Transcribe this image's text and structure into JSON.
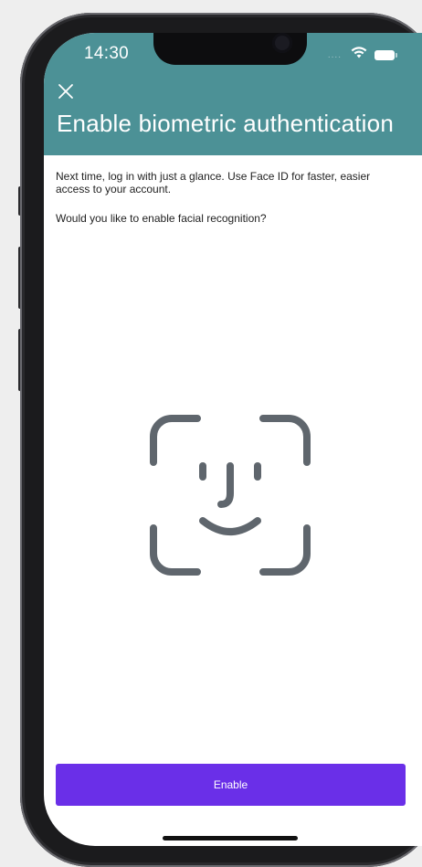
{
  "status_bar": {
    "time": "14:30",
    "signal": "....",
    "wifi_icon": "wifi-icon",
    "battery_icon": "battery-icon"
  },
  "header": {
    "close_icon": "close-icon",
    "title": "Enable biometric authentication",
    "background_color": "#4c9196"
  },
  "content": {
    "description": "Next time, log in with just a glance. Use Face ID for faster, easier access to your account.",
    "question": "Would you like to enable facial recognition?",
    "illustration_icon": "face-id-icon"
  },
  "actions": {
    "enable_label": "Enable",
    "enable_color": "#6a2fe8"
  }
}
